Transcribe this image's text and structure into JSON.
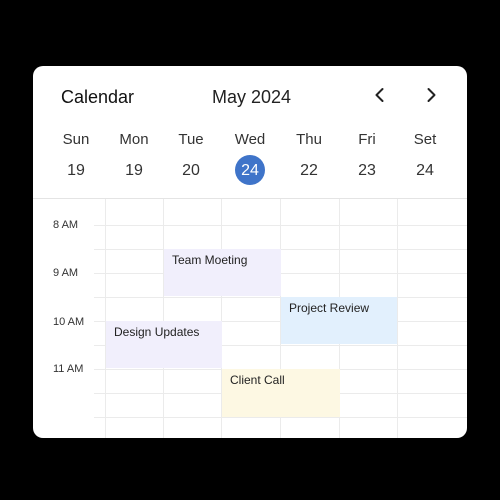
{
  "header": {
    "title": "Calendar",
    "month": "May 2024"
  },
  "days": [
    {
      "name": "Sun",
      "date": "19"
    },
    {
      "name": "Mon",
      "date": "19"
    },
    {
      "name": "Tue",
      "date": "20"
    },
    {
      "name": "Wed",
      "date": "24",
      "selected": true
    },
    {
      "name": "Thu",
      "date": "22"
    },
    {
      "name": "Fri",
      "date": "23"
    },
    {
      "name": "Set",
      "date": "24"
    }
  ],
  "times": [
    "8 AM",
    "9 AM",
    "10 AM",
    "11 AM"
  ],
  "events": [
    {
      "title": "Team Moeting",
      "color": "#f1effc"
    },
    {
      "title": "Project Review",
      "color": "#e2f0fd"
    },
    {
      "title": "Design Updates",
      "color": "#f1effc"
    },
    {
      "title": "Client Call",
      "color": "#fdf8e3"
    }
  ],
  "colors": {
    "accent": "#3f74c9"
  }
}
